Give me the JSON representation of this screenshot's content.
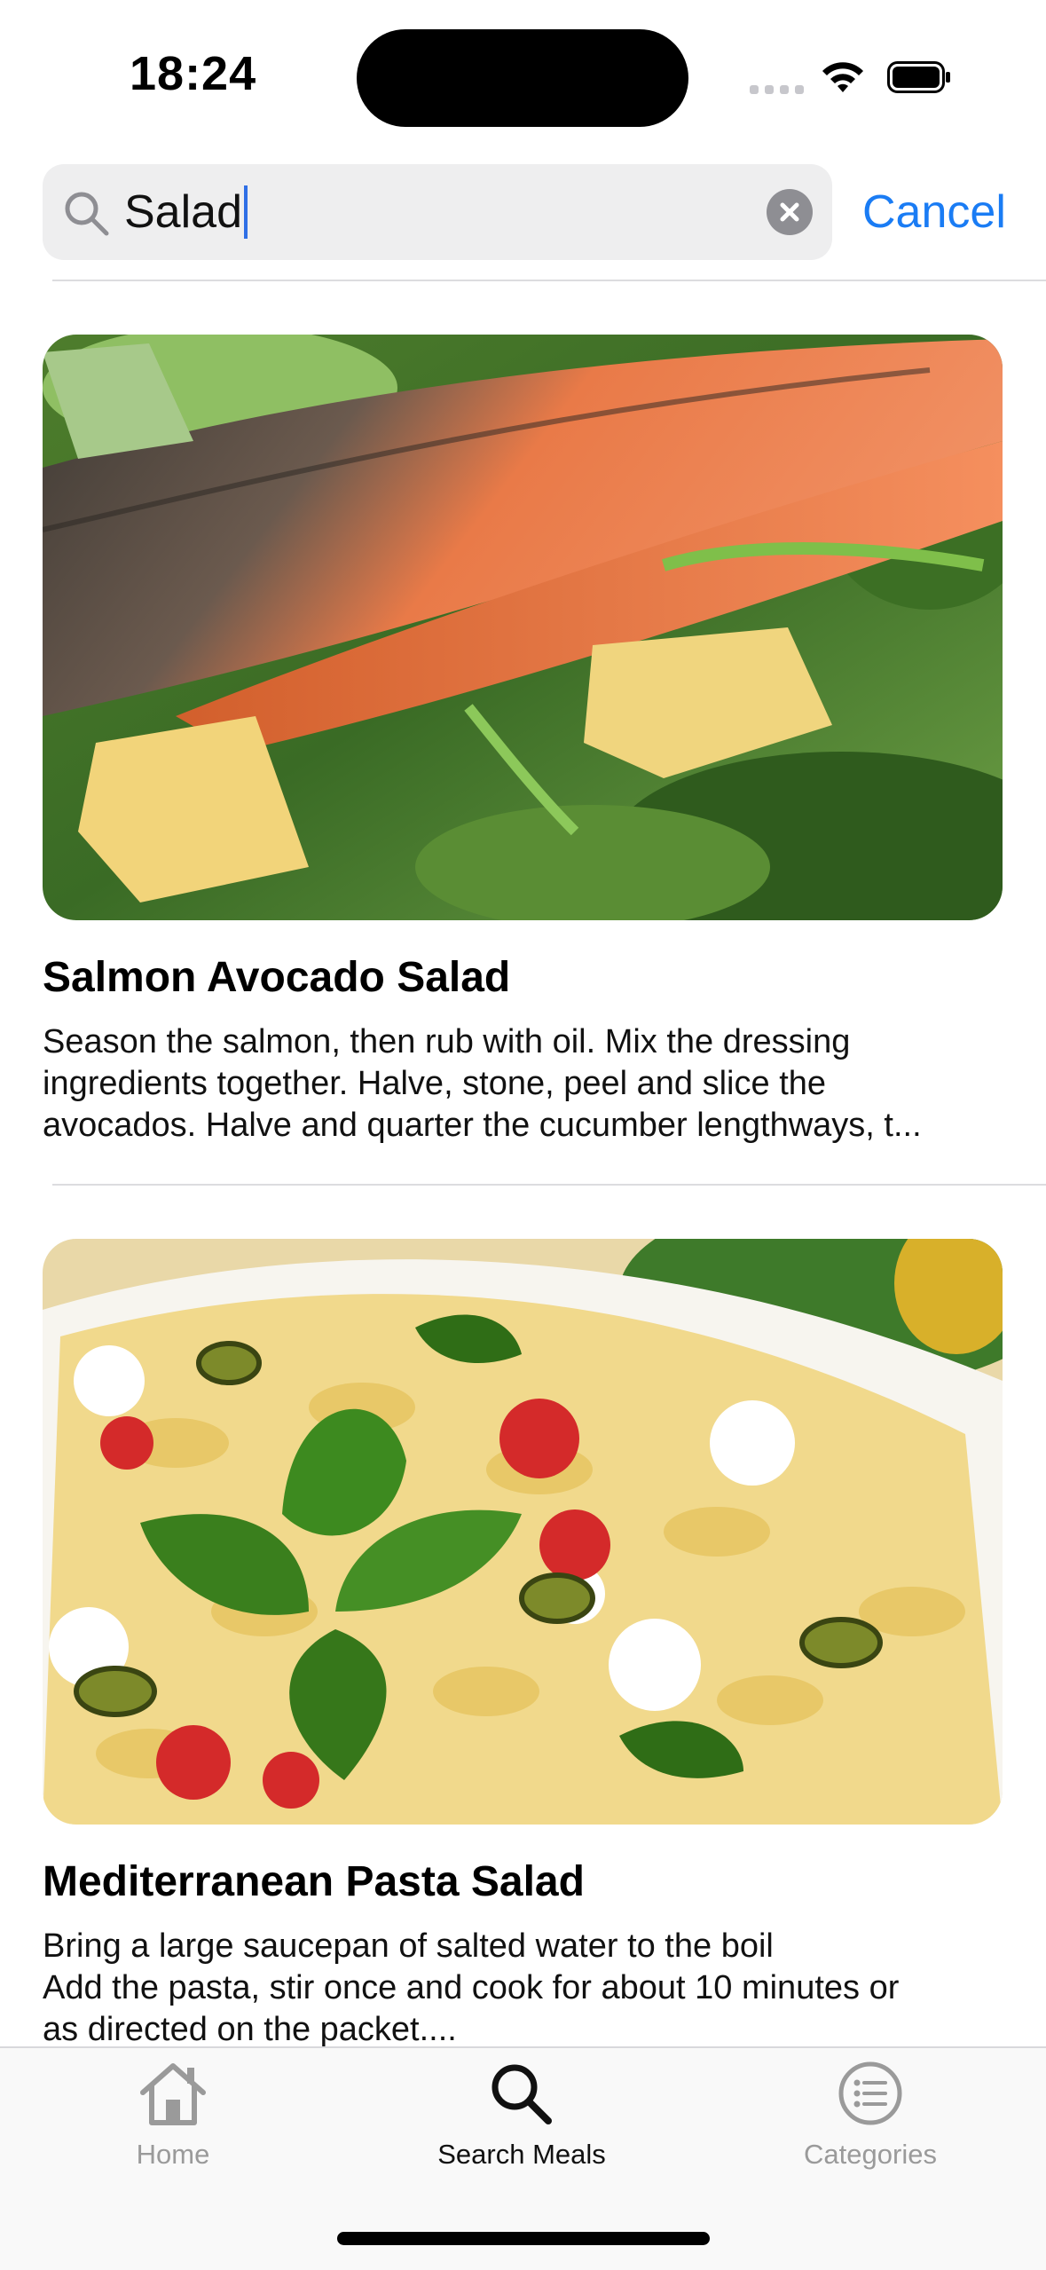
{
  "status_bar": {
    "time": "18:24"
  },
  "search": {
    "query": "Salad",
    "cancel_label": "Cancel"
  },
  "meals": [
    {
      "title": "Salmon Avocado Salad",
      "description": "Season the salmon, then rub with oil. Mix the dressing\ningredients together. Halve, stone, peel and slice the\navocados. Halve and quarter the cucumber lengthways, t..."
    },
    {
      "title": "Mediterranean Pasta Salad",
      "description": "Bring a large saucepan of salted water to the boil\nAdd the pasta, stir once and cook for about 10 minutes or\nas directed on the packet...."
    }
  ],
  "tab_bar": {
    "tabs": [
      {
        "label": "Home",
        "icon": "house-icon",
        "active": false
      },
      {
        "label": "Search Meals",
        "icon": "magnifier-icon",
        "active": true
      },
      {
        "label": "Categories",
        "icon": "list-icon",
        "active": false
      }
    ]
  },
  "colors": {
    "accent": "#1a7cf4",
    "inactive_tab": "#9a9a9a",
    "search_field_bg": "#eeeeef"
  }
}
